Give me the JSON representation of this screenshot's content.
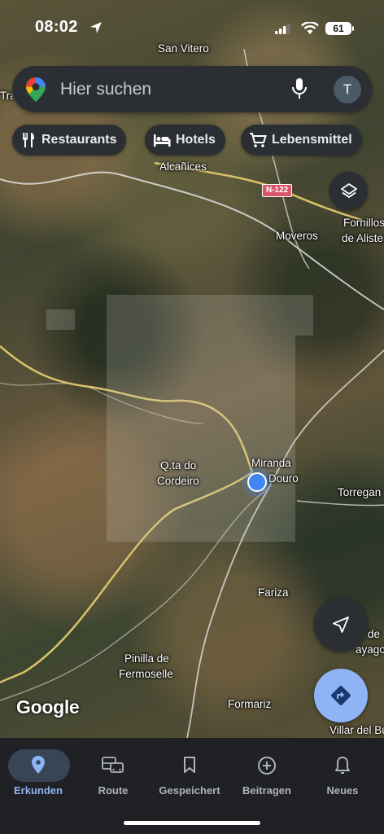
{
  "status_bar": {
    "time": "08:02",
    "battery": "61"
  },
  "search": {
    "placeholder": "Hier suchen",
    "avatar_initial": "T"
  },
  "chips": [
    {
      "label": "Restaurants",
      "icon": "fork-knife-icon"
    },
    {
      "label": "Hotels",
      "icon": "bed-icon"
    },
    {
      "label": "Lebensmittel",
      "icon": "cart-icon"
    }
  ],
  "map": {
    "labels": {
      "san_vitero": "San Vitero",
      "tra": "Tra",
      "alcanices": "Alcañices",
      "moveros": "Moveros",
      "fornillos": "Fornillos",
      "de_aliste": "de Aliste",
      "qta_do": "Q.ta do",
      "cordeiro": "Cordeiro",
      "miranda": "Miranda",
      "douro": "Douro",
      "torregan": "Torregan",
      "fariza": "Fariza",
      "de": "de",
      "sayago": "ayago",
      "pinilla_de": "Pinilla de",
      "fermoselle": "Fermoselle",
      "formariz": "Formariz",
      "villar_del_bu": "Villar del Bu"
    },
    "road_badge": "N-122",
    "attribution": "Google"
  },
  "nav": [
    {
      "label": "Erkunden",
      "icon": "location-pin-icon",
      "active": true
    },
    {
      "label": "Route",
      "icon": "commute-icon",
      "active": false
    },
    {
      "label": "Gespeichert",
      "icon": "bookmark-icon",
      "active": false
    },
    {
      "label": "Beitragen",
      "icon": "add-circle-icon",
      "active": false
    },
    {
      "label": "Neues",
      "icon": "bell-icon",
      "active": false
    }
  ],
  "colors": {
    "accent": "#8fb4f6",
    "location_dot": "#4285f4",
    "surface": "#2b2f33"
  }
}
